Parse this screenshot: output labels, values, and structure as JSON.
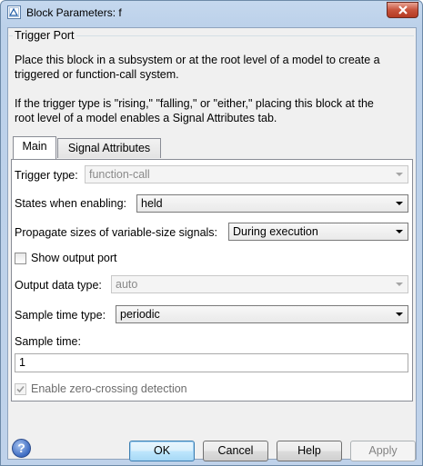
{
  "window": {
    "title": "Block Parameters: f"
  },
  "group": {
    "legend": "Trigger Port",
    "desc1": "Place this block in a subsystem or at the root level of a model to create a\ntriggered or function-call system.",
    "desc2": "If the trigger type is \"rising,\" \"falling,\" or \"either,\" placing this block at the\nroot level of a model enables a Signal Attributes tab."
  },
  "tabs": [
    {
      "label": "Main",
      "active": true
    },
    {
      "label": "Signal Attributes",
      "active": false
    }
  ],
  "main": {
    "trigger_type_label": "Trigger type:",
    "trigger_type_value": "function-call",
    "states_label": "States when enabling:",
    "states_value": "held",
    "propagate_label": "Propagate sizes of variable-size signals:",
    "propagate_value": "During execution",
    "show_output_label": "Show output port",
    "show_output_checked": false,
    "output_dtype_label": "Output data type:",
    "output_dtype_value": "auto",
    "sample_type_label": "Sample time type:",
    "sample_type_value": "periodic",
    "sample_time_label": "Sample time:",
    "sample_time_value": "1",
    "zero_cross_label": "Enable zero-crossing detection",
    "zero_cross_checked": true
  },
  "buttons": {
    "help_icon_glyph": "?",
    "ok": "OK",
    "cancel": "Cancel",
    "help": "Help",
    "apply": "Apply"
  },
  "colors": {
    "title_bar": "#bfd2ea",
    "close_button": "#c7533b",
    "default_button_border": "#3c7fb1"
  }
}
